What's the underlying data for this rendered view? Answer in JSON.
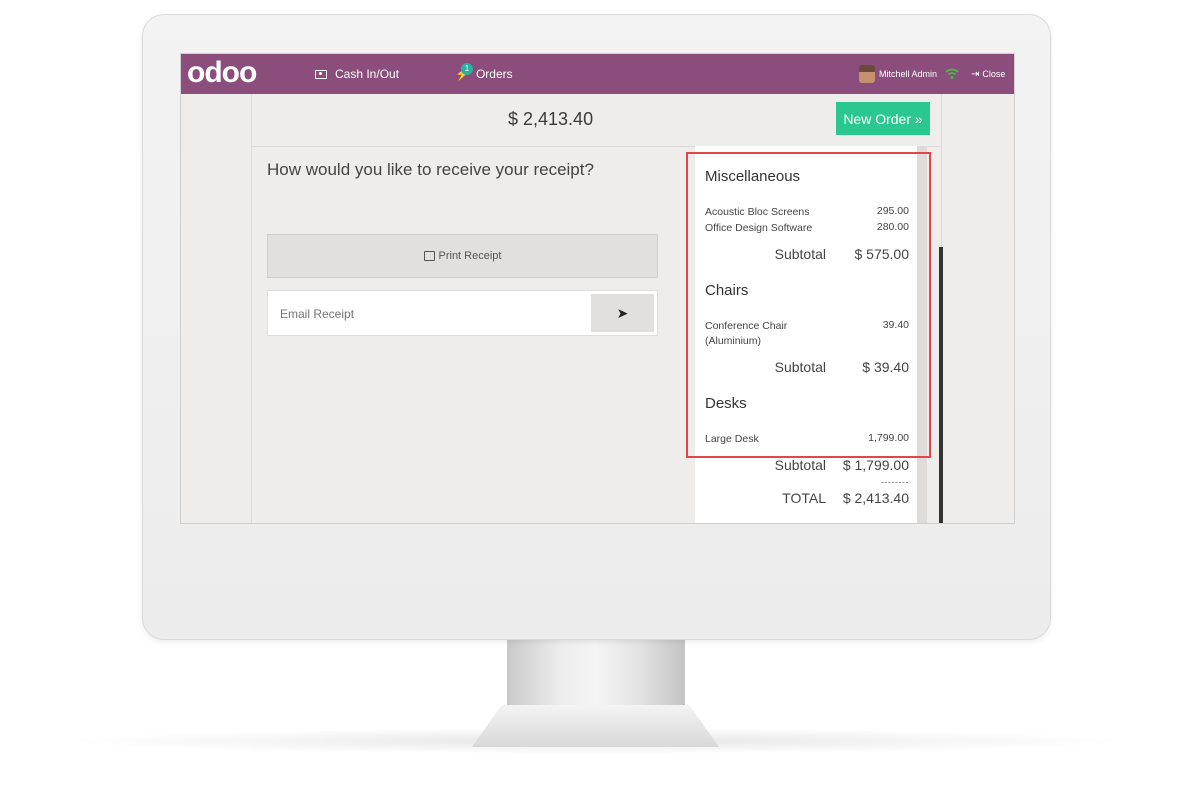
{
  "topbar": {
    "logo": "odoo",
    "cash_label": "Cash In/Out",
    "orders_label": "Orders",
    "orders_badge": "1",
    "user_name": "Mitchell Admin",
    "close_label": "Close"
  },
  "header": {
    "amount": "$ 2,413.40",
    "new_order_label": "New Order »"
  },
  "receipt_options": {
    "question": "How would you like to receive your receipt?",
    "print_label": "Print Receipt",
    "email_placeholder": "Email Receipt"
  },
  "receipt": {
    "categories": [
      {
        "name": "Miscellaneous",
        "items": [
          {
            "name": "Acoustic Bloc Screens",
            "price": "295.00"
          },
          {
            "name": "Office Design Software",
            "price": "280.00"
          }
        ],
        "subtotal_label": "Subtotal",
        "subtotal": "$ 575.00"
      },
      {
        "name": "Chairs",
        "items": [
          {
            "name": "Conference Chair",
            "name_line2": "(Aluminium)",
            "price": "39.40"
          }
        ],
        "subtotal_label": "Subtotal",
        "subtotal": "$ 39.40"
      },
      {
        "name": "Desks",
        "items": [
          {
            "name": "Large Desk",
            "price": "1,799.00"
          }
        ],
        "subtotal_label": "Subtotal",
        "subtotal": "$ 1,799.00"
      }
    ],
    "separator": "--------",
    "total_label": "TOTAL",
    "total": "$ 2,413.40"
  },
  "colors": {
    "topbar": "#8a4d7c",
    "new_order": "#2ac88f",
    "highlight": "#e64545"
  }
}
